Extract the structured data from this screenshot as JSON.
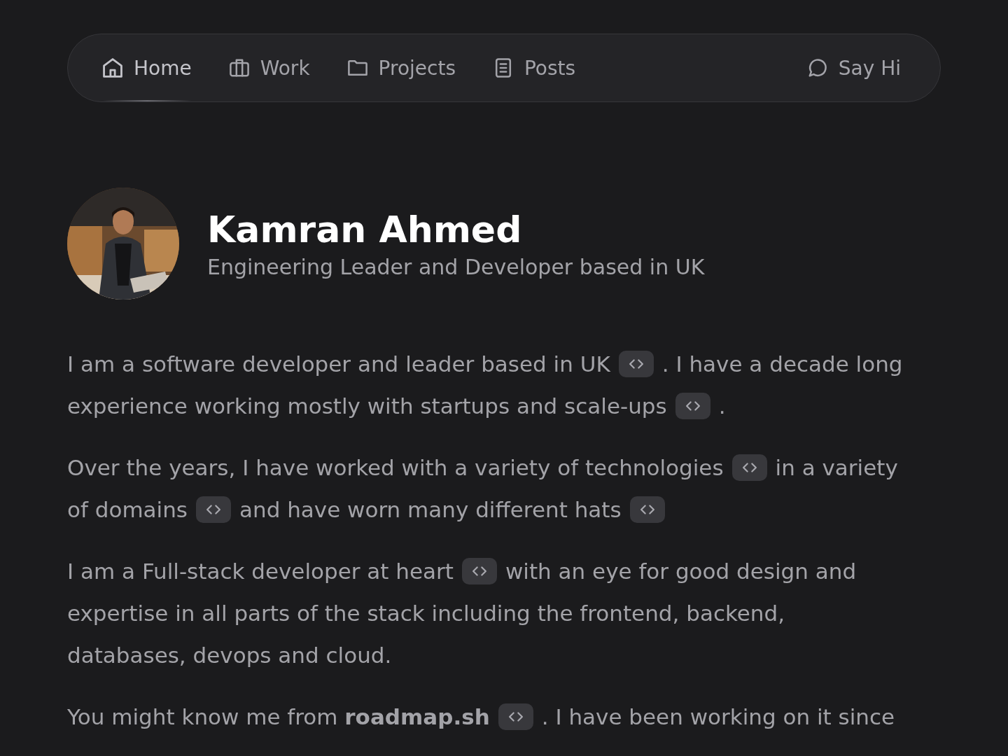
{
  "nav": {
    "items": [
      {
        "label": "Home",
        "selected": true
      },
      {
        "label": "Work",
        "selected": false
      },
      {
        "label": "Projects",
        "selected": false
      },
      {
        "label": "Posts",
        "selected": false
      }
    ],
    "cta": {
      "label": "Say Hi"
    }
  },
  "profile": {
    "name": "Kamran Ahmed",
    "tagline": "Engineering Leader and Developer based in UK"
  },
  "paragraphs": [
    {
      "lines": [
        [
          {
            "kind": "text",
            "text": "I am a software developer and leader based in UK"
          },
          {
            "kind": "badge"
          },
          {
            "kind": "text",
            "text": ". I have a decade long"
          }
        ],
        [
          {
            "kind": "text",
            "text": "experience working mostly with startups and scale-ups"
          },
          {
            "kind": "badge"
          },
          {
            "kind": "text",
            "text": "."
          }
        ]
      ]
    },
    {
      "lines": [
        [
          {
            "kind": "text",
            "text": "Over the years, I have worked with a variety of technologies"
          },
          {
            "kind": "badge"
          },
          {
            "kind": "text",
            "text": "in a variety"
          }
        ],
        [
          {
            "kind": "text",
            "text": "of domains"
          },
          {
            "kind": "badge"
          },
          {
            "kind": "text",
            "text": "and have worn many different hats"
          },
          {
            "kind": "badge"
          }
        ]
      ]
    },
    {
      "lines": [
        [
          {
            "kind": "text",
            "text": "I am a Full-stack developer at heart"
          },
          {
            "kind": "badge"
          },
          {
            "kind": "text",
            "text": "with an eye for good design and"
          }
        ],
        [
          {
            "kind": "text",
            "text": "expertise in all parts of the stack including the frontend, backend,"
          }
        ],
        [
          {
            "kind": "text",
            "text": "databases, devops and cloud."
          }
        ]
      ]
    },
    {
      "lines": [
        [
          {
            "kind": "text",
            "text": "You might know me from **roadmap.sh**"
          },
          {
            "kind": "badge"
          },
          {
            "kind": "text",
            "text": ". I have been working on it since"
          }
        ]
      ]
    }
  ]
}
